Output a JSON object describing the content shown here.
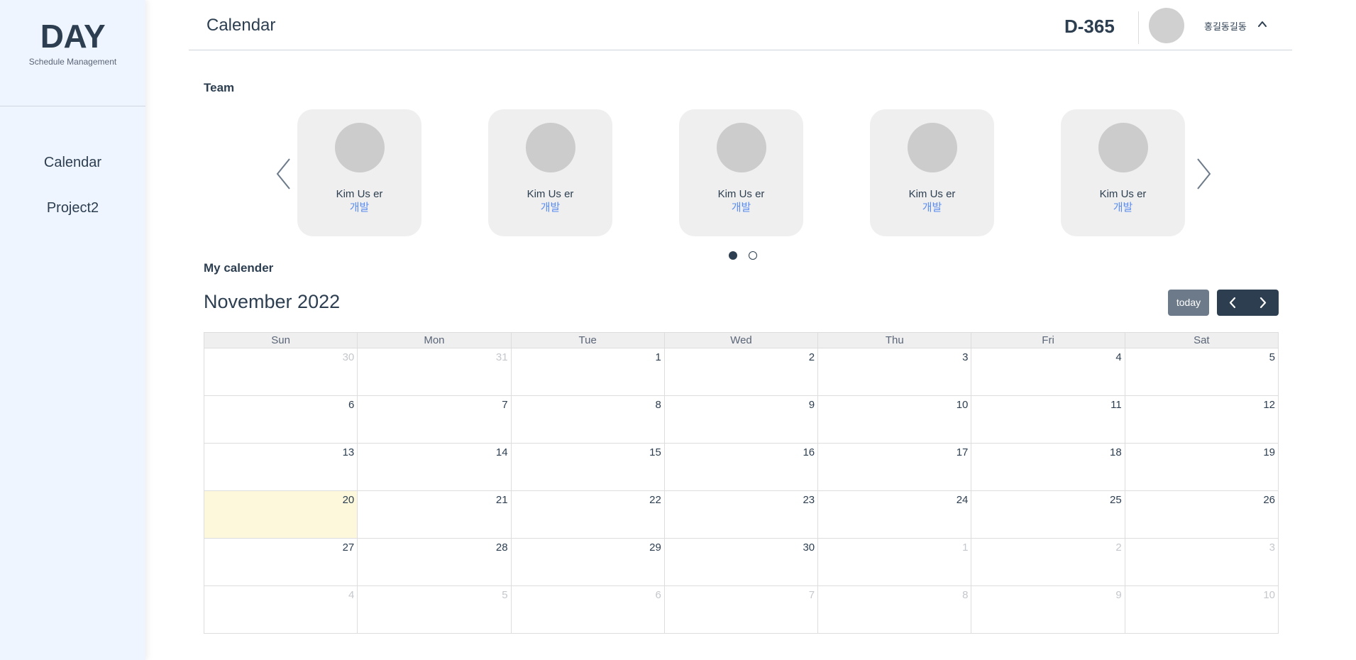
{
  "sidebar": {
    "logo_title": "DAY",
    "logo_subtitle": "Schedule Management",
    "nav": [
      {
        "label": "Calendar"
      },
      {
        "label": "Project2"
      }
    ]
  },
  "header": {
    "title": "Calendar",
    "dday": "D-365",
    "user_name": "홍길동길동",
    "user_menu_icon": "chevron-up-icon"
  },
  "team": {
    "label": "Team",
    "prev_icon": "chevron-left-icon",
    "next_icon": "chevron-right-icon",
    "members": [
      {
        "name": "Kim Us er",
        "role": "개발"
      },
      {
        "name": "Kim Us er",
        "role": "개발"
      },
      {
        "name": "Kim Us er",
        "role": "개발"
      },
      {
        "name": "Kim Us er",
        "role": "개발"
      },
      {
        "name": "Kim Us er",
        "role": "개발"
      }
    ],
    "pages": 2,
    "active_page": 1
  },
  "calendar": {
    "label": "My calender",
    "month_title": "November 2022",
    "today_button": "today",
    "weekdays": [
      "Sun",
      "Mon",
      "Tue",
      "Wed",
      "Thu",
      "Fri",
      "Sat"
    ],
    "weeks": [
      [
        {
          "d": "30",
          "other": true
        },
        {
          "d": "31",
          "other": true
        },
        {
          "d": "1"
        },
        {
          "d": "2"
        },
        {
          "d": "3"
        },
        {
          "d": "4"
        },
        {
          "d": "5"
        }
      ],
      [
        {
          "d": "6"
        },
        {
          "d": "7"
        },
        {
          "d": "8"
        },
        {
          "d": "9"
        },
        {
          "d": "10"
        },
        {
          "d": "11"
        },
        {
          "d": "12"
        }
      ],
      [
        {
          "d": "13"
        },
        {
          "d": "14"
        },
        {
          "d": "15"
        },
        {
          "d": "16"
        },
        {
          "d": "17"
        },
        {
          "d": "18"
        },
        {
          "d": "19"
        }
      ],
      [
        {
          "d": "20",
          "today": true
        },
        {
          "d": "21"
        },
        {
          "d": "22"
        },
        {
          "d": "23"
        },
        {
          "d": "24"
        },
        {
          "d": "25"
        },
        {
          "d": "26"
        }
      ],
      [
        {
          "d": "27"
        },
        {
          "d": "28"
        },
        {
          "d": "29"
        },
        {
          "d": "30"
        },
        {
          "d": "1",
          "other": true
        },
        {
          "d": "2",
          "other": true
        },
        {
          "d": "3",
          "other": true
        }
      ],
      [
        {
          "d": "4",
          "other": true
        },
        {
          "d": "5",
          "other": true
        },
        {
          "d": "6",
          "other": true
        },
        {
          "d": "7",
          "other": true
        },
        {
          "d": "8",
          "other": true
        },
        {
          "d": "9",
          "other": true
        },
        {
          "d": "10",
          "other": true
        }
      ]
    ]
  },
  "colors": {
    "primary": "#2c3e50",
    "sidebar_bg": "#eff5ff",
    "accent_role": "#5b8df0",
    "today_button_bg": "#6c7a89",
    "today_cell_bg": "#fdf8dc"
  }
}
